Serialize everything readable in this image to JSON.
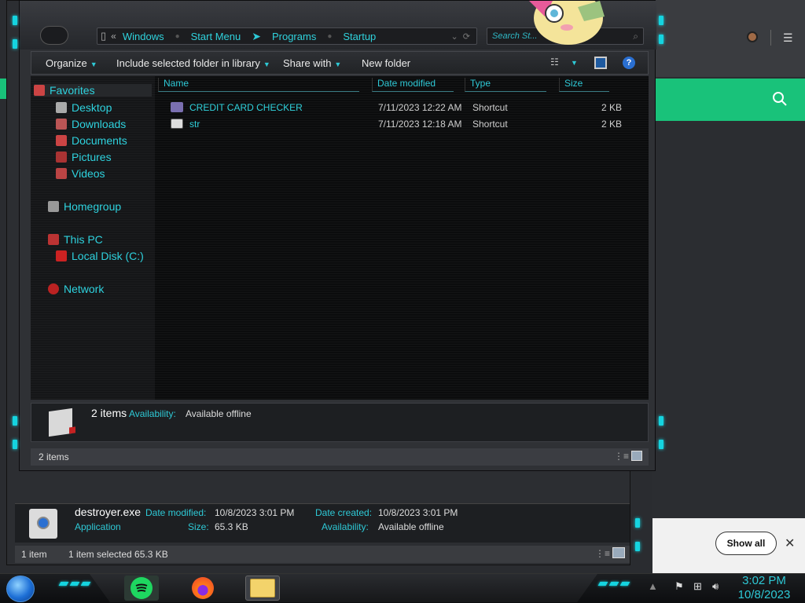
{
  "explorer": {
    "address": {
      "crumbs": [
        "Windows",
        "Start Menu",
        "Programs",
        "Startup"
      ],
      "back_glyph": "«"
    },
    "search_placeholder": "Search St...",
    "toolbar": {
      "organize": "Organize",
      "include": "Include selected folder in library",
      "share": "Share with",
      "new_folder": "New folder"
    },
    "nav": {
      "favorites": "Favorites",
      "desktop": "Desktop",
      "downloads": "Downloads",
      "documents": "Documents",
      "pictures": "Pictures",
      "videos": "Videos",
      "homegroup": "Homegroup",
      "this_pc": "This PC",
      "local_disk": "Local Disk (C:)",
      "network": "Network"
    },
    "columns": {
      "name": "Name",
      "date": "Date modified",
      "type": "Type",
      "size": "Size"
    },
    "files": [
      {
        "name": "CREDIT CARD CHECKER",
        "date": "7/11/2023 12:22 AM",
        "type": "Shortcut",
        "size": "2 KB"
      },
      {
        "name": "str",
        "date": "7/11/2023 12:18 AM",
        "type": "Shortcut",
        "size": "2 KB"
      }
    ],
    "details": {
      "count": "2 items",
      "availability_label": "Availability:",
      "availability_value": "Available offline"
    },
    "status": "2 items"
  },
  "back_window": {
    "filename": "destroyer.exe",
    "type": "Application",
    "date_modified_label": "Date modified:",
    "date_modified": "10/8/2023 3:01 PM",
    "size_label": "Size:",
    "size": "65.3 KB",
    "date_created_label": "Date created:",
    "date_created": "10/8/2023 3:01 PM",
    "availability_label": "Availability:",
    "availability": "Available offline",
    "status_count": "1 item",
    "status_selected": "1 item selected  65.3 KB"
  },
  "browser": {
    "show_all": "Show all",
    "close": "✕",
    "menu": "⋮"
  },
  "taskbar": {
    "time": "3:02 PM",
    "date": "10/8/2023"
  },
  "colors": {
    "accent": "#2ec9d6",
    "green": "#19c27a"
  }
}
